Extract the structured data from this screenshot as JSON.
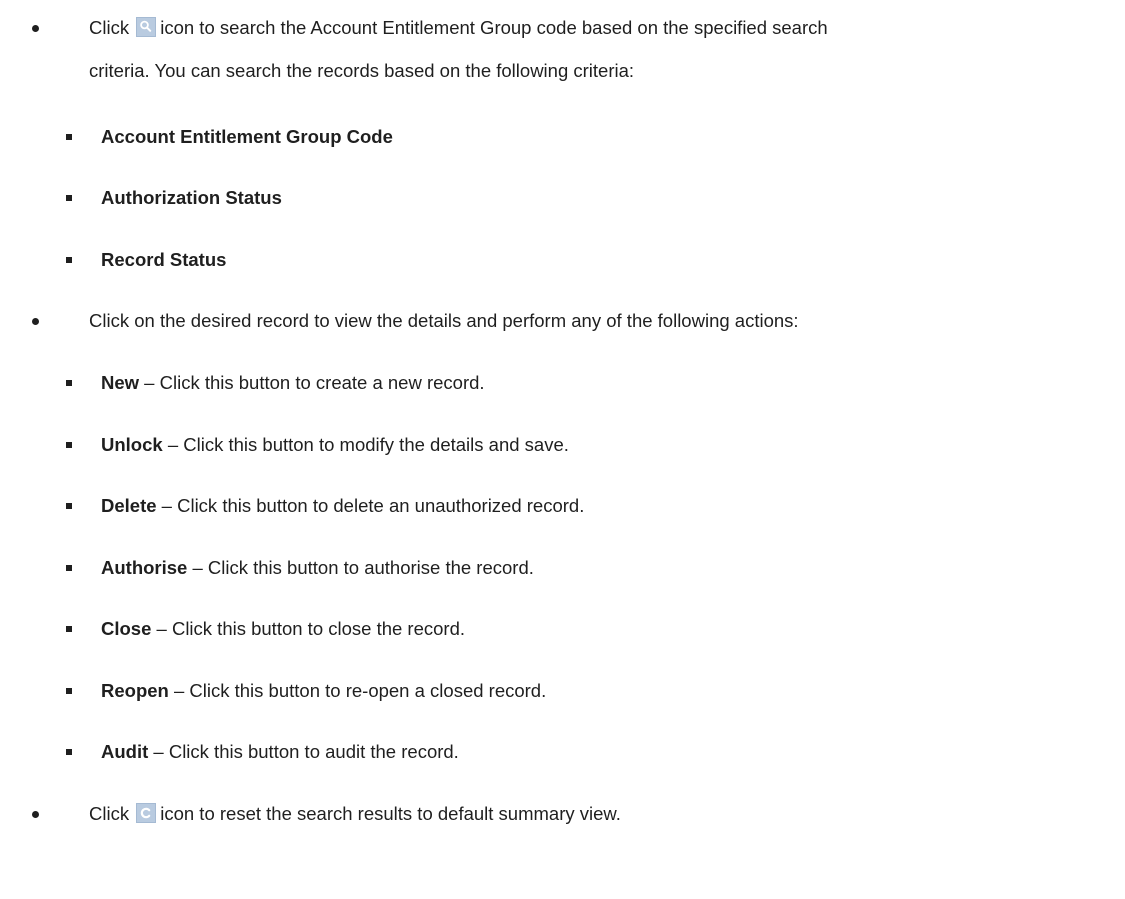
{
  "bullets": [
    {
      "pre": "Click",
      "icon": "search-icon",
      "post": "icon to search the Account Entitlement Group code based on the specified search",
      "cont": "criteria. You can search the records based on the following criteria:",
      "sub": [
        "Account Entitlement Group Code",
        "Authorization Status",
        "Record Status"
      ]
    },
    {
      "text": "Click on the desired record to view the details and perform any of the following actions:",
      "actions": [
        {
          "label": "New",
          "desc": " – Click this button to create a new record."
        },
        {
          "label": "Unlock",
          "desc": " – Click this button to modify the details and save."
        },
        {
          "label": "Delete",
          "desc": " – Click this button to delete an unauthorized record."
        },
        {
          "label": "Authorise",
          "desc": " – Click this button to authorise the record."
        },
        {
          "label": "Close",
          "desc": " – Click this button to close the record."
        },
        {
          "label": "Reopen",
          "desc": " – Click this button to re-open a closed record."
        },
        {
          "label": "Audit",
          "desc": " – Click this button to audit the record."
        }
      ]
    },
    {
      "pre": "Click",
      "icon": "reset-icon",
      "post": "icon to reset the search results to default summary view."
    }
  ],
  "colors": {
    "text": "#1f1f1f",
    "icon_bg": "#b9cbe0"
  }
}
